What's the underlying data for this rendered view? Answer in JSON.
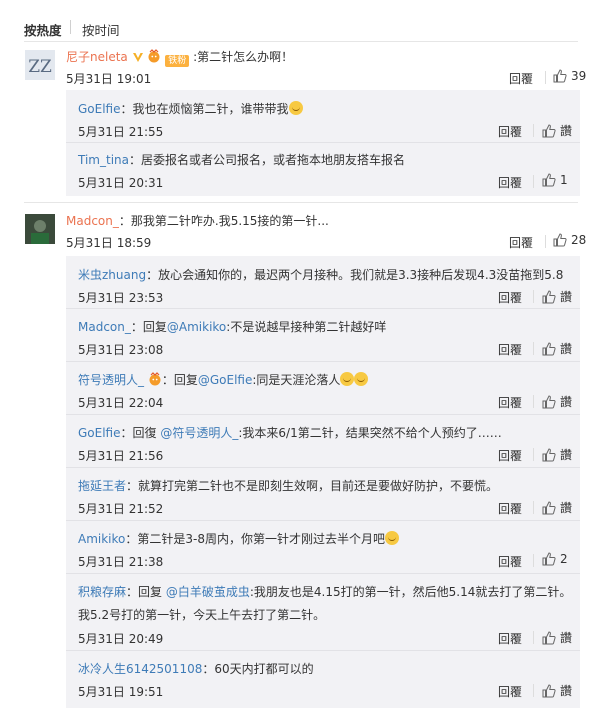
{
  "sort": {
    "hot": "按热度",
    "time": "按时间"
  },
  "labels": {
    "reply": "回覆",
    "like": "讚"
  },
  "comments": [
    {
      "user": "尼子neleta",
      "badge_text": "铁粉",
      "text": ":第二针怎么办啊！",
      "time": "5月31日 19:01",
      "likes": "39",
      "replies": [
        {
          "user": "GoElfie",
          "text": "：我也在烦恼第二针，谁带带我",
          "time": "5月31日 21:55",
          "likes": ""
        },
        {
          "user": "Tim_tina",
          "text": "：居委报名或者公司报名，或者拖本地朋友搭车报名",
          "time": "5月31日 20:31",
          "likes": "1"
        }
      ]
    },
    {
      "user": "Madcon_",
      "text": "：那我第二针咋办.我5.15接的第一针...",
      "time": "5月31日 18:59",
      "likes": "28",
      "replies": [
        {
          "user": "米虫zhuang",
          "text": "：放心会通知你的，最迟两个月接种。我们就是3.3接种后发现4.3没苗拖到5.8",
          "time": "5月31日 23:53",
          "likes": ""
        },
        {
          "user": "Madcon_",
          "text_pre": "：回复",
          "mention": "@Amikiko",
          "text_post": ":不是说越早接种第二针越好咩",
          "time": "5月31日 23:08",
          "likes": ""
        },
        {
          "user": "符号透明人_",
          "text_pre": "：回复",
          "mention": "@GoElfie",
          "text_post": ":同是天涯沦落人",
          "time": "5月31日 22:04",
          "likes": ""
        },
        {
          "user": "GoElfie",
          "text_pre": "：回復 ",
          "mention": "@符号透明人_",
          "text_post": ":我本来6/1第二针，结果突然不给个人预约了……",
          "time": "5月31日 21:56",
          "likes": ""
        },
        {
          "user": "拖延王者",
          "text": "：就算打完第二针也不是即刻生效啊，目前还是要做好防护，不要慌。",
          "time": "5月31日 21:52",
          "likes": ""
        },
        {
          "user": "Amikiko",
          "text": "：第二针是3-8周内，你第一针才刚过去半个月吧",
          "time": "5月31日 21:38",
          "likes": "2"
        },
        {
          "user": "积粮存麻",
          "text_pre": "：回复 ",
          "mention": "@白羊破茧成虫",
          "text_post": ":我朋友也是4.15打的第一针，然后他5.14就去打了第二针。",
          "text_line2": "我5.2号打的第一针，今天上午去打了第二针。",
          "time": "5月31日 20:49",
          "likes": ""
        },
        {
          "user": "冰冷人生6142501108",
          "text": "：60天内打都可以的",
          "time": "5月31日 19:51",
          "likes": ""
        }
      ]
    }
  ],
  "colors": {
    "username": "#eb7350",
    "mention": "#3e7bb7",
    "reply_bg": "#f2f2f5"
  }
}
